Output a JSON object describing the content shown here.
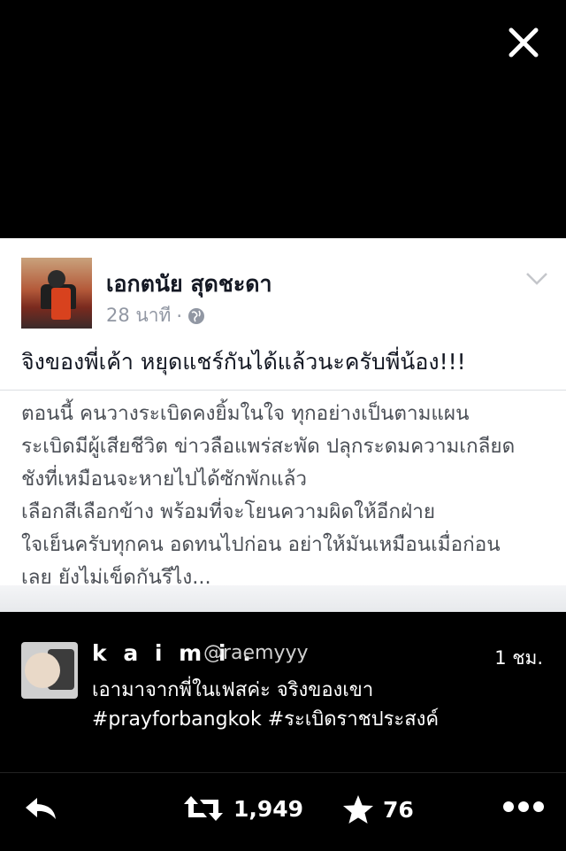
{
  "overlay": {
    "close_icon": "close-icon"
  },
  "facebook_post": {
    "author": "เอกตนัย สุดชะดา",
    "time": "28 นาที",
    "separator": "·",
    "status": "จิงของพี่เค้า หยุดแชร์กันได้แล้วนะครับพี่น้อง!!!",
    "body_lines": [
      "ตอนนี้ คนวางระเบิดคงยิ้มในใจ ทุกอย่างเป็นตามแผน",
      "ระเบิดมีผู้เสียชีวิต ข่าวลือแพร่สะพัด ปลุกระดมความเกลียด",
      "ชังที่เหมือนจะหายไปได้ซักพักแล้ว",
      "เลือกสีเลือกข้าง พร้อมที่จะโยนความผิดให้อีกฝ่าย",
      "ใจเย็นครับทุกคน อดทนไปก่อน อย่าให้มันเหมือนเมื่อก่อน",
      "เลย ยังไม่เข็ดกันรึไง..."
    ]
  },
  "tweet": {
    "display_name": "k a i m i .",
    "handle": "@raemyyy",
    "time": "1 ชม.",
    "text_line1": "เอามาจากพี่ในเฟสค่ะ จริงของเขา",
    "text_line2": "#prayforbangkok #ระเบิดราชประสงค์"
  },
  "actions": {
    "retweet_count": "1,949",
    "favorite_count": "76"
  }
}
